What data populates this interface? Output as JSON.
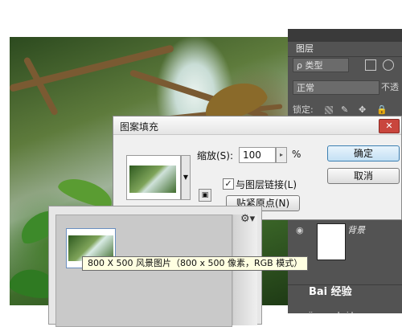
{
  "layers_panel": {
    "tab_label": "图层",
    "kind_filter": "ρ 类型",
    "blend_mode": "正常",
    "opacity_label": "不透",
    "lock_label": "锁定:",
    "layer_name": "背景"
  },
  "dialog": {
    "title": "图案填充",
    "close": "✕",
    "scale_label": "缩放(S):",
    "scale_value": "100",
    "percent": "%",
    "link_label": "与图层链接(L)",
    "snap_button": "贴紧原点(N)",
    "ok_button": "确定",
    "cancel_button": "取消"
  },
  "picker": {
    "tooltip": "800 X 500 风景图片（800 x 500 像素，RGB 模式）"
  },
  "watermark": {
    "brand": "Bai 经验",
    "url": "jingyan.baidu.com"
  },
  "colors": {
    "panel_bg": "#535353",
    "close_red": "#c9463d",
    "tooltip_bg": "#ffffe1"
  }
}
